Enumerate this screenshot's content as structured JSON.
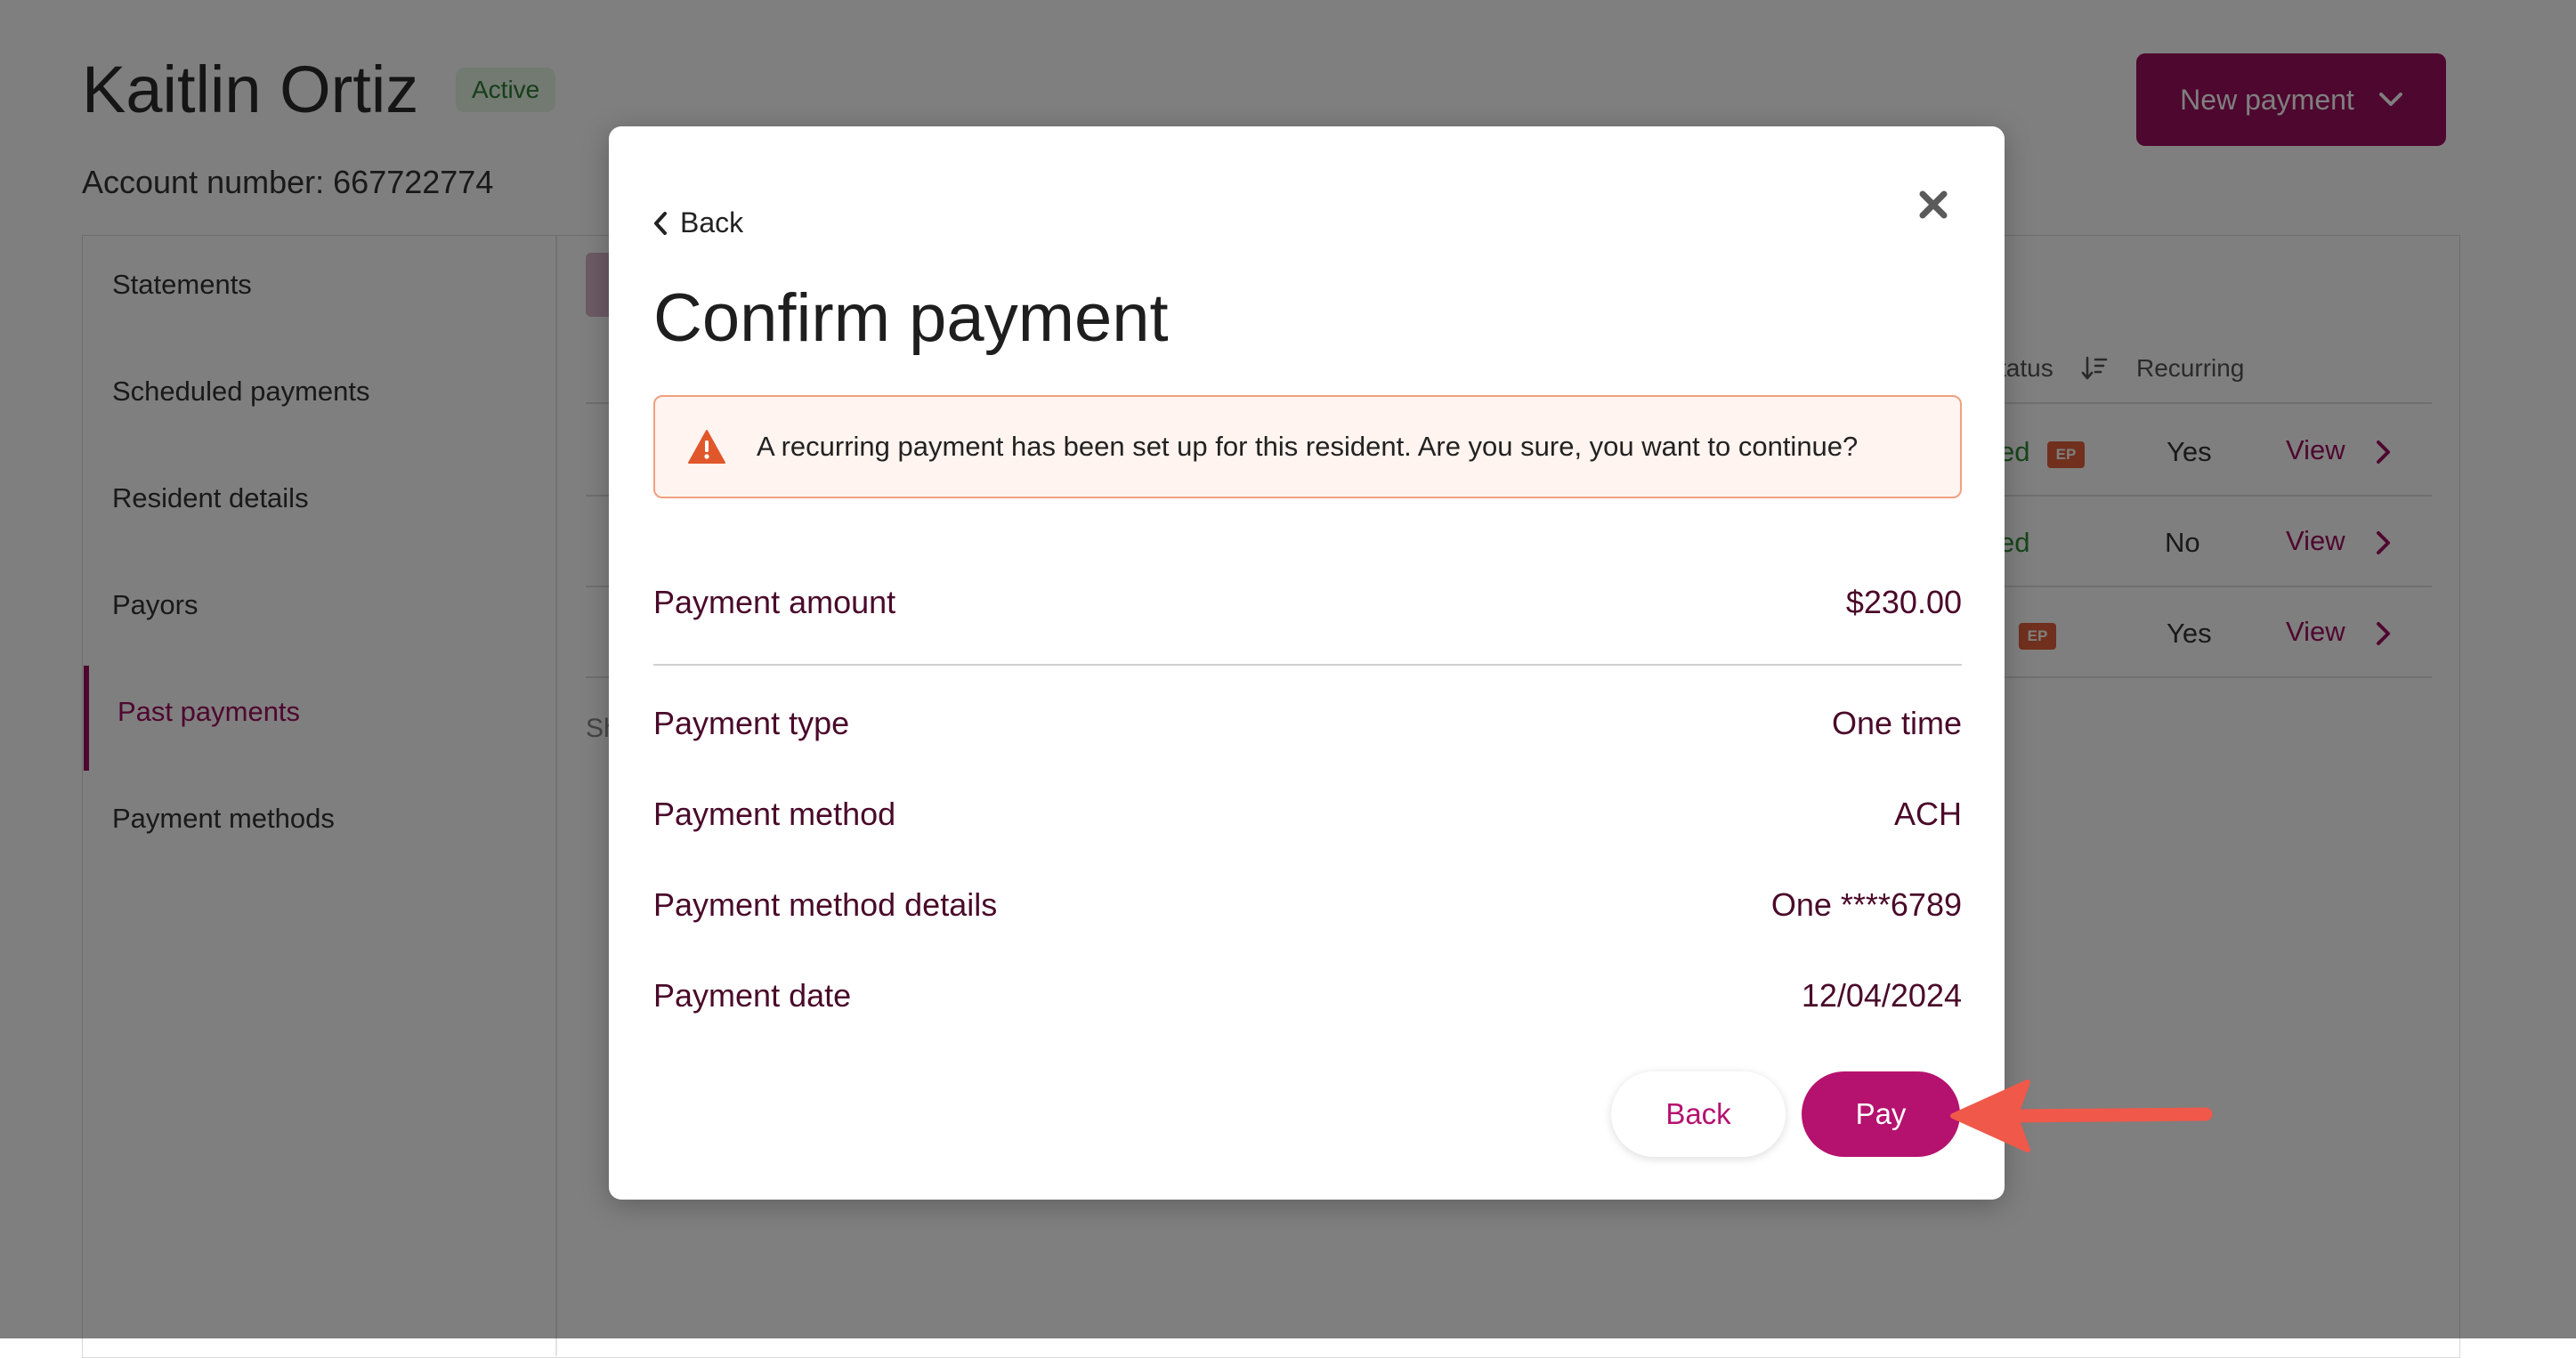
{
  "header": {
    "resident_name": "Kaitlin Ortiz",
    "status_badge": "Active",
    "account_number_text": "Account number: 667722774",
    "new_payment_label": "New payment"
  },
  "sidebar": {
    "items": [
      {
        "label": "Statements"
      },
      {
        "label": "Scheduled payments"
      },
      {
        "label": "Resident details"
      },
      {
        "label": "Payors"
      },
      {
        "label": "Past payments",
        "active": true
      },
      {
        "label": "Payment methods"
      }
    ]
  },
  "table": {
    "headers": {
      "status": "tatus",
      "recurring": "Recurring"
    },
    "rows": [
      {
        "status_fragment": "ed",
        "ep": "EP",
        "recurring": "Yes",
        "action": "View"
      },
      {
        "status_fragment": "ed",
        "ep": "",
        "recurring": "No",
        "action": "View"
      },
      {
        "status_fragment": "",
        "ep": "EP",
        "recurring": "Yes",
        "action": "View"
      }
    ],
    "footer_fragment": "Sh"
  },
  "modal": {
    "back_link": "Back",
    "title": "Confirm payment",
    "warning": "A recurring payment has been set up for this resident. Are you sure, you want to continue?",
    "details": [
      {
        "label": "Payment amount",
        "value": "$230.00"
      },
      {
        "label": "Payment type",
        "value": "One time"
      },
      {
        "label": "Payment method",
        "value": "ACH"
      },
      {
        "label": "Payment method details",
        "value": "One ****6789"
      },
      {
        "label": "Payment date",
        "value": "12/04/2024"
      }
    ],
    "back_button": "Back",
    "pay_button": "Pay"
  },
  "colors": {
    "brand": "#9c0f5f",
    "pay_button": "#b5126f",
    "warning_border": "#f0a080",
    "warning_icon": "#e0572b",
    "annotation_arrow": "#f0584a"
  },
  "icons": [
    "chevron-left-icon",
    "close-icon",
    "warning-icon",
    "chevron-down-icon",
    "sort-icon",
    "chevron-right-icon",
    "annotation-arrow"
  ]
}
